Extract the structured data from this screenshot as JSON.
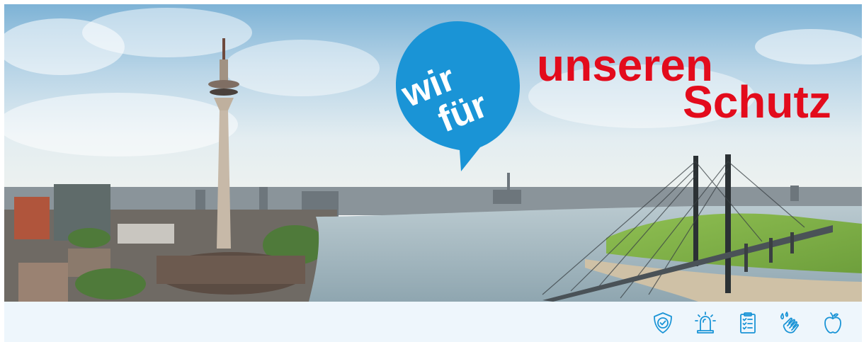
{
  "hero": {
    "bubble": {
      "line1": "wir",
      "line2": "für",
      "color": "#1a94d6"
    },
    "headline": {
      "line1": "unseren",
      "line2": "Schutz",
      "color": "#e30b1c"
    }
  },
  "toolbar": {
    "background": "#eef6fc",
    "accent": "#1a94d6",
    "icons": [
      "shield-check-icon",
      "siren-icon",
      "clipboard-checklist-icon",
      "hand-washing-icon",
      "apple-icon"
    ]
  }
}
